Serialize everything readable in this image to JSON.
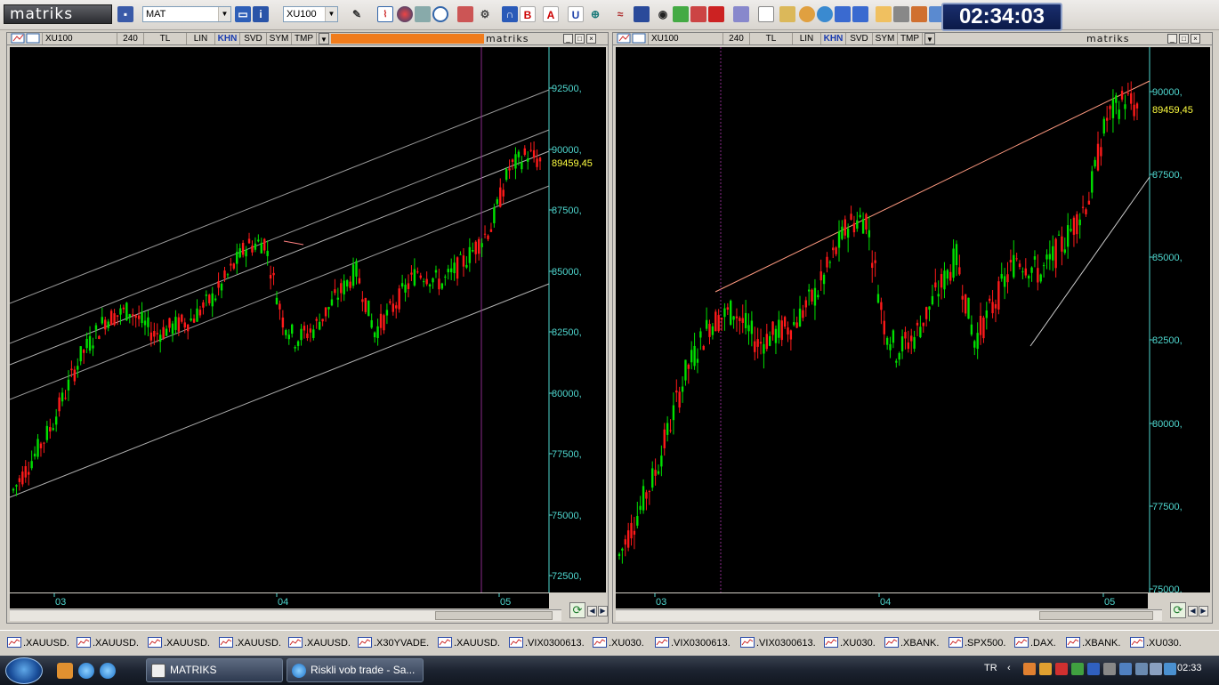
{
  "app": {
    "logo_text": "matriks",
    "clock": "02:34:03",
    "toolbar": {
      "template_combo": "MAT",
      "symbol_combo": "XU100"
    },
    "colors": {
      "up": "#00e000",
      "down": "#ff1a1a",
      "axis_text": "#4fd8d0",
      "last_price": "#ffff40",
      "clock_bg": "#0b1a48"
    }
  },
  "panes": [
    {
      "toolbar": {
        "symbol": "XU100",
        "period": "240",
        "currency": "TL",
        "scale": "LIN",
        "khn": "KHN",
        "svd": "SVD",
        "sym": "SYM",
        "tmp": "TMP",
        "brand": "matriks"
      },
      "y_ticks": [
        "92500,",
        "90000,",
        "87500,",
        "85000,",
        "82500,",
        "80000,",
        "77500,",
        "75000,",
        "72500,"
      ],
      "x_ticks": [
        "03",
        "04",
        "05"
      ],
      "last_price": "89459,45"
    },
    {
      "toolbar": {
        "symbol": "XU100",
        "period": "240",
        "currency": "TL",
        "scale": "LIN",
        "khn": "KHN",
        "svd": "SVD",
        "sym": "SYM",
        "tmp": "TMP",
        "brand": "matriks"
      },
      "y_ticks": [
        "90000,",
        "87500,",
        "85000,",
        "82500,",
        "80000,",
        "77500,",
        "75000,"
      ],
      "x_ticks": [
        "03",
        "04",
        "05"
      ],
      "last_price": "89459,45"
    }
  ],
  "symbol_tabs": [
    ".XAUUSD.",
    ".XAUUSD.",
    ".XAUUSD.",
    ".XAUUSD.",
    ".XAUUSD.",
    ".X30YVADE.",
    ".XAUUSD.",
    ".VIX0300613.",
    ".XU030.",
    ".VIX0300613.",
    ".VIX0300613.",
    ".XU030.",
    ".XBANK.",
    ".SPX500.",
    ".DAX.",
    ".XBANK.",
    ".XU030."
  ],
  "taskbar": {
    "buttons": [
      "MATRIKS",
      "Riskli vob trade - Sa..."
    ],
    "language": "TR",
    "time": "02:33"
  }
}
